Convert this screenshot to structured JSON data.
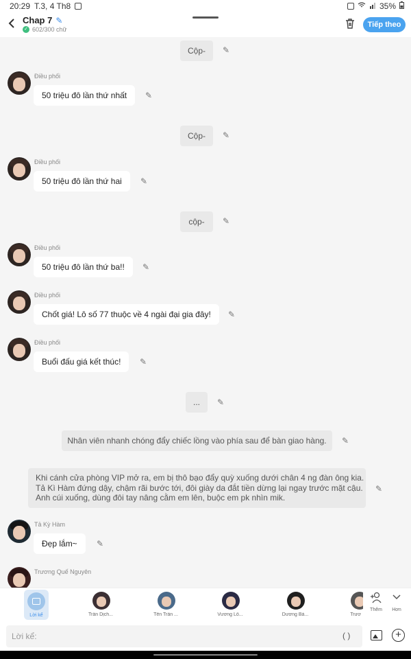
{
  "status_bar": {
    "time": "20:29",
    "date": "T.3, 4 Th8",
    "battery": "35%"
  },
  "header": {
    "title": "Chap 7",
    "subtitle": "602/300 chữ",
    "next_label": "Tiếp theo",
    "accent": "#4aa3ef"
  },
  "messages": [
    {
      "kind": "center",
      "text": "Cộp-"
    },
    {
      "kind": "speaker",
      "name": "Điều phối",
      "text": "50 triệu đô lần thứ nhất"
    },
    {
      "kind": "center",
      "text": "Cộp-"
    },
    {
      "kind": "speaker",
      "name": "Điều phối",
      "text": "50 triệu đô lần thứ hai"
    },
    {
      "kind": "center",
      "text": "cộp-"
    },
    {
      "kind": "speaker",
      "name": "Điều phối",
      "text": "50 triệu đô lần thứ ba!!"
    },
    {
      "kind": "speaker",
      "name": "Điều phối",
      "text": "Chốt giá! Lô số 77 thuộc về 4 ngài đại gia đây!"
    },
    {
      "kind": "speaker",
      "name": "Điều phối",
      "text": "Buổi đấu giá kết thúc!"
    },
    {
      "kind": "center",
      "text": "..."
    },
    {
      "kind": "narration",
      "text": "Nhân viên nhanh chóng đẩy chiếc lồng vào phía sau để bàn giao hàng."
    },
    {
      "kind": "narration",
      "lines": [
        "Khi cánh cửa phòng VIP mở ra, em bị thô bạo đẩy quỳ xuống dưới chân 4 ng đàn ông kia.",
        "Tả Kì Hàm đứng dậy, chậm rãi bước tới, đôi giày da đắt tiền dừng lại ngay trước mặt cậu.",
        "Anh cúi xuống, dùng đôi tay nâng cằm em lên, buộc em pk nhìn mik."
      ]
    },
    {
      "kind": "speaker",
      "name": "Tả Kỳ Hàm",
      "text": "Đẹp lắm~"
    },
    {
      "kind": "speaker",
      "name": "Trương Quế Nguyên",
      "text": ""
    }
  ],
  "tabs": {
    "active": "Lời kể",
    "characters": [
      "Trần Dịch...",
      "Tên Trần ...",
      "Vương Lô...",
      "Dương Bá...",
      "Trươ"
    ],
    "more_add": "Thêm",
    "more_more": "Hơn"
  },
  "input": {
    "placeholder": "Lời kể:",
    "paren": "( )"
  }
}
